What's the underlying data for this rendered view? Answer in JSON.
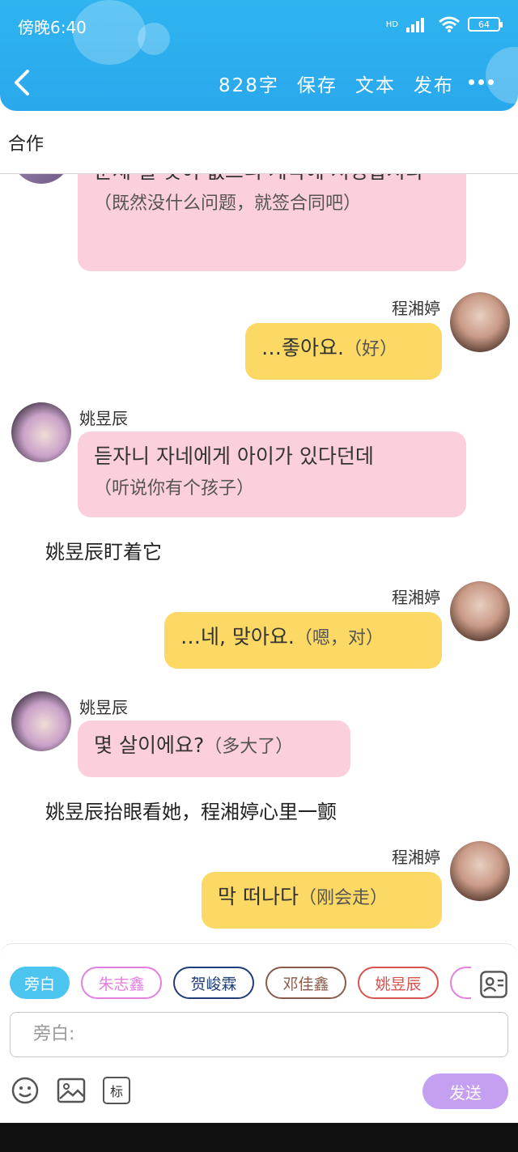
{
  "status_bar": {
    "time": "傍晚6:40",
    "network": "HD",
    "battery": "64"
  },
  "header": {
    "word_count": "828字",
    "save": "保存",
    "text": "文本",
    "publish": "发布"
  },
  "subtitle": "合作",
  "messages": [
    {
      "speaker": "",
      "text": "문제 될 것이 없으니 계약에 서명합시다",
      "translation": "（既然没什么问题，就签合同吧）"
    },
    {
      "speaker": "程湘婷",
      "text": "…좋아요.",
      "translation": "（好）"
    },
    {
      "speaker": "姚昱辰",
      "text": "듣자니 자네에게 아이가 있다던데",
      "translation": "（听说你有个孩子）"
    },
    {
      "narration": "姚昱辰盯着它"
    },
    {
      "speaker": "程湘婷",
      "text": "…네, 맞아요.",
      "translation": "（嗯，对）"
    },
    {
      "speaker": "姚昱辰",
      "text": "몇 살이에요?",
      "translation": "（多大了）"
    },
    {
      "narration": "姚昱辰抬眼看她，程湘婷心里一颤"
    },
    {
      "speaker": "程湘婷",
      "text": "막 떠나다",
      "translation": "（刚会走）"
    }
  ],
  "role_chips": [
    {
      "label": "旁白",
      "color": "#4cc4f0",
      "selected": true
    },
    {
      "label": "朱志鑫",
      "color": "#e27fe0",
      "selected": false
    },
    {
      "label": "贺峻霖",
      "color": "#1f3d7a",
      "selected": false
    },
    {
      "label": "邓佳鑫",
      "color": "#8a5a4a",
      "selected": false
    },
    {
      "label": "姚昱辰",
      "color": "#d9534f",
      "selected": false
    }
  ],
  "input": {
    "placeholder": "旁白:"
  },
  "tools": {
    "mark_label": "标",
    "send": "发送"
  },
  "icons": [
    "back-icon",
    "more-icon",
    "signal-icon",
    "wifi-icon",
    "battery-icon",
    "contacts-icon",
    "emoji-icon",
    "image-icon",
    "mark-icon"
  ]
}
